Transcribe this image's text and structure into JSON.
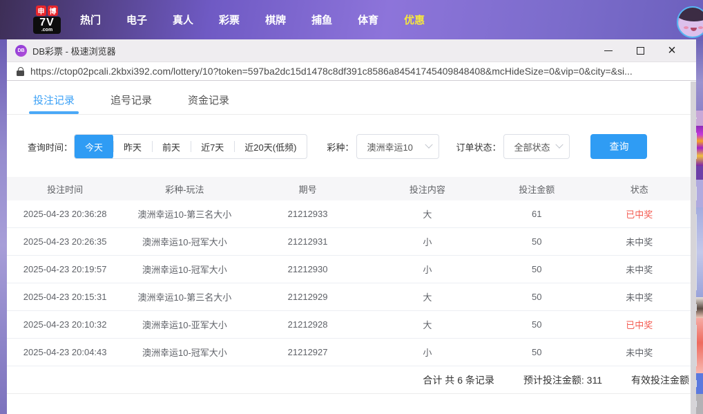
{
  "site_nav": {
    "logo": {
      "cn1": "申",
      "cn2": "博",
      "mid": "7V",
      "bottom": ".com"
    },
    "items": [
      {
        "label": "热门",
        "active": false
      },
      {
        "label": "电子",
        "active": false
      },
      {
        "label": "真人",
        "active": false
      },
      {
        "label": "彩票",
        "active": false
      },
      {
        "label": "棋牌",
        "active": false
      },
      {
        "label": "捕鱼",
        "active": false
      },
      {
        "label": "体育",
        "active": false
      },
      {
        "label": "优惠",
        "active": true
      }
    ]
  },
  "browser": {
    "tab_icon_text": "DB",
    "title": "DB彩票 - 极速浏览器",
    "url": "https://ctop02pcali.2kbxi392.com/lottery/10?token=597ba2dc15d1478c8df391c8586a84541745409848408&mcHideSize=0&vip=0&city=&si...",
    "controls": {
      "minimize": "minimize",
      "maximize": "maximize",
      "close": "×"
    }
  },
  "page_tabs": [
    {
      "label": "投注记录",
      "active": true
    },
    {
      "label": "追号记录",
      "active": false
    },
    {
      "label": "资金记录",
      "active": false
    }
  ],
  "filters": {
    "time_label": "查询时间：",
    "time_options": [
      {
        "label": "今天",
        "active": true
      },
      {
        "label": "昨天",
        "active": false
      },
      {
        "label": "前天",
        "active": false
      },
      {
        "label": "近7天",
        "active": false
      },
      {
        "label": "近20天(低频)",
        "active": false
      }
    ],
    "lottery_label": "彩种：",
    "lottery_value": "澳洲幸运10",
    "status_label": "订单状态：",
    "status_value": "全部状态",
    "query_button": "查询"
  },
  "table": {
    "columns": [
      "投注时间",
      "彩种-玩法",
      "期号",
      "投注内容",
      "投注金额",
      "状态"
    ],
    "rows": [
      [
        "2025-04-23 20:36:28",
        "澳洲幸运10-第三名大小",
        "21212933",
        "大",
        "61",
        "已中奖"
      ],
      [
        "2025-04-23 20:26:35",
        "澳洲幸运10-冠军大小",
        "21212931",
        "小",
        "50",
        "未中奖"
      ],
      [
        "2025-04-23 20:19:57",
        "澳洲幸运10-冠军大小",
        "21212930",
        "小",
        "50",
        "未中奖"
      ],
      [
        "2025-04-23 20:15:31",
        "澳洲幸运10-第三名大小",
        "21212929",
        "大",
        "50",
        "未中奖"
      ],
      [
        "2025-04-23 20:10:32",
        "澳洲幸运10-亚军大小",
        "21212928",
        "大",
        "50",
        "已中奖"
      ],
      [
        "2025-04-23 20:04:43",
        "澳洲幸运10-冠军大小",
        "21212927",
        "小",
        "50",
        "未中奖"
      ]
    ],
    "won_status": "已中奖"
  },
  "summary": {
    "total_records": "合计 共 6 条记录",
    "expected_amount": "预计投注金额: 311",
    "valid_amount": "有效投注金额"
  },
  "colors": {
    "accent_blue": "#2f9cf4",
    "tab_active_blue": "#3aa0f6",
    "win_status_red": "#f45b51",
    "nav_highlight_yellow": "#f5e63f",
    "topbar_purple": "#7b63c8"
  }
}
